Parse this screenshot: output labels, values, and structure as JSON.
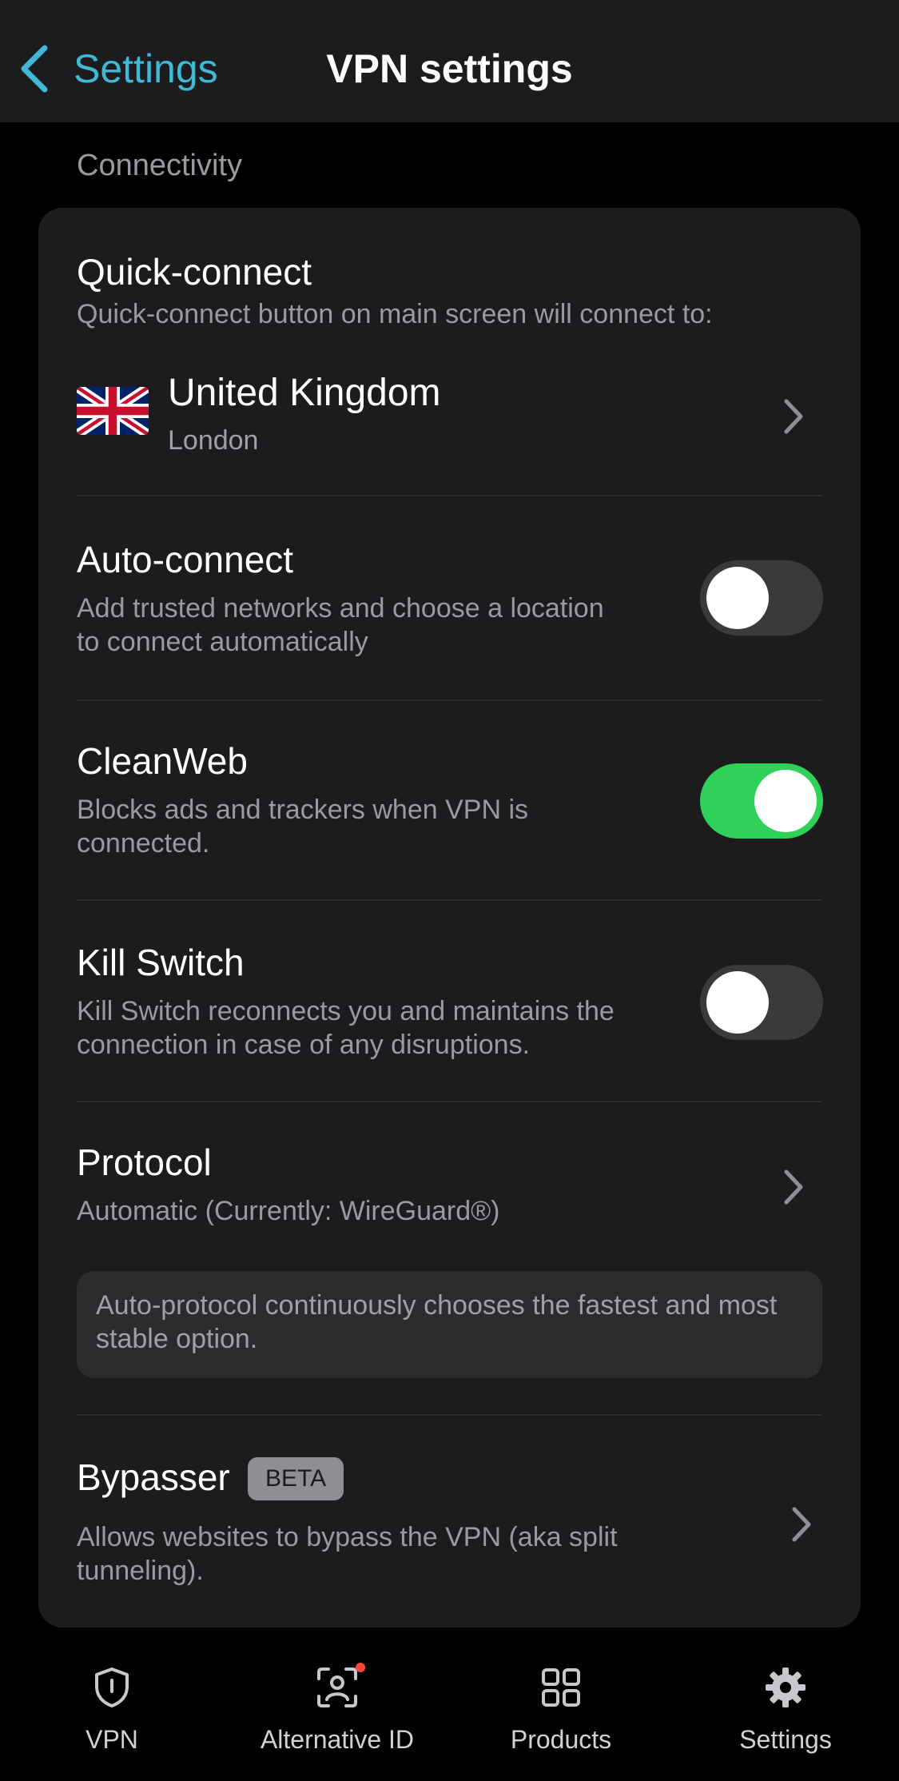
{
  "nav": {
    "back_label": "Settings",
    "title": "VPN settings"
  },
  "section": {
    "label": "Connectivity"
  },
  "quick_connect": {
    "title": "Quick-connect",
    "description": "Quick-connect button on main screen will connect to:",
    "country": "United Kingdom",
    "city": "London",
    "flag_icon": "uk-flag-icon"
  },
  "auto_connect": {
    "title": "Auto-connect",
    "description": "Add trusted networks and choose a location to connect automatically",
    "enabled": false
  },
  "clean_web": {
    "title": "CleanWeb",
    "description": "Blocks ads and trackers when VPN is connected.",
    "enabled": true
  },
  "kill_switch": {
    "title": "Kill Switch",
    "description": "Kill Switch reconnects you and maintains the connection in case of any disruptions.",
    "enabled": false
  },
  "protocol": {
    "title": "Protocol",
    "value": "Automatic (Currently: WireGuard®)",
    "info": "Auto-protocol continuously chooses the fastest and most stable option."
  },
  "bypasser": {
    "title": "Bypasser",
    "badge": "BETA",
    "description": "Allows websites to bypass the VPN (aka split tunneling)."
  },
  "tabs": [
    {
      "label": "VPN",
      "icon": "shield-icon"
    },
    {
      "label": "Alternative ID",
      "icon": "face-id-icon",
      "has_notification": true
    },
    {
      "label": "Products",
      "icon": "grid-icon"
    },
    {
      "label": "Settings",
      "icon": "gear-icon",
      "active": true
    }
  ],
  "colors": {
    "accent": "#3fb9d6",
    "toggle_on": "#30d158",
    "notification": "#ff453a"
  }
}
